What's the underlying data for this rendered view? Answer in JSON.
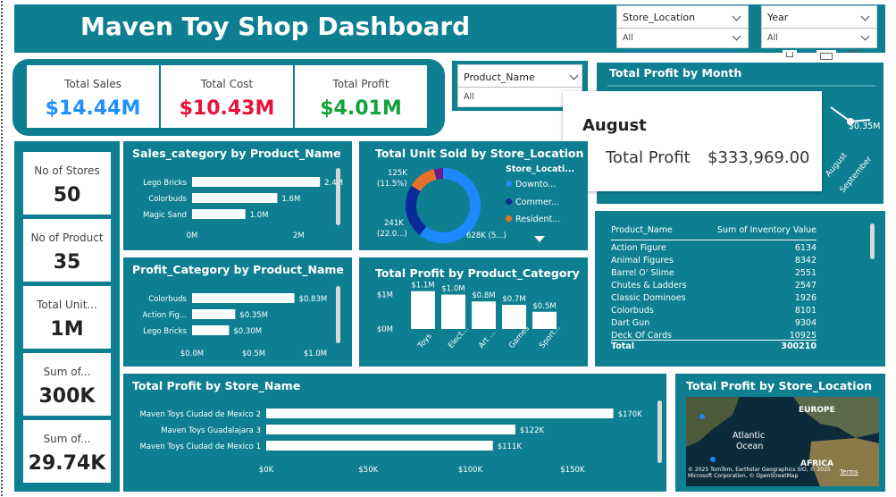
{
  "header": {
    "title": "Maven Toy Shop Dashboard"
  },
  "slicers": {
    "store_location": {
      "label": "Store_Location",
      "value": "All"
    },
    "year": {
      "label": "Year",
      "value": "All"
    },
    "product_name": {
      "label": "Product_Name",
      "value": "All"
    }
  },
  "kpis": [
    {
      "label": "Total Sales",
      "value": "$14.44M",
      "color": "#1e90ff"
    },
    {
      "label": "Total Cost",
      "value": "$10.43M",
      "color": "#e8123a"
    },
    {
      "label": "Total Profit",
      "value": "$4.01M",
      "color": "#14a33a"
    }
  ],
  "cards": [
    {
      "label": "No of Stores",
      "value": "50"
    },
    {
      "label": "No of Product",
      "value": "35"
    },
    {
      "label": "Total Unit...",
      "value": "1M"
    },
    {
      "label": "Sum of...",
      "value": "300K"
    },
    {
      "label": "Sum of...",
      "value": "29.74K"
    }
  ],
  "tooltip": {
    "title": "August",
    "label": "Total Profit",
    "value": "$333,969.00"
  },
  "monthly_chart": {
    "title": "Total Profit by Month",
    "value_label": "$0.35M",
    "tick_labels": [
      "August",
      "September"
    ]
  },
  "inventory_table": {
    "headers": [
      "Product_Name",
      "Sum of Inventory Value"
    ],
    "rows": [
      [
        "Action Figure",
        "6134"
      ],
      [
        "Animal Figures",
        "8342"
      ],
      [
        "Barrel O' Slime",
        "2551"
      ],
      [
        "Chutes & Ladders",
        "2547"
      ],
      [
        "Classic Dominoes",
        "1926"
      ],
      [
        "Colorbuds",
        "8101"
      ],
      [
        "Dart Gun",
        "9304"
      ],
      [
        "Deck Of Cards",
        "10925"
      ]
    ],
    "total": [
      "Total",
      "300210"
    ]
  },
  "map": {
    "title": "Total Profit by Store_Location",
    "labels": [
      "EUROPE",
      "Atlantic",
      "Ocean",
      "AFRICA"
    ],
    "attribution": "© 2025 TomTom, Earthstar Geographics SIO, © 2025 Microsoft Corporation, © OpenStreetMap",
    "terms": "Terms"
  },
  "chart_data": [
    {
      "type": "bar",
      "title": "Sales_category by Product_Name",
      "categories": [
        "Lego Bricks",
        "Colorbuds",
        "Magic Sand"
      ],
      "values": [
        2.4,
        1.6,
        1.0
      ],
      "value_labels": [
        "2.4M",
        "1.6M",
        "1.0M"
      ],
      "xlim": [
        0,
        2.8
      ],
      "ticks": [
        {
          "v": 0,
          "label": "0M"
        },
        {
          "v": 2,
          "label": "2M"
        }
      ]
    },
    {
      "type": "bar",
      "title": "Profit_Category by Product_Name",
      "categories": [
        "Colorbuds",
        "Action Fig...",
        "Lego Bricks"
      ],
      "values": [
        0.83,
        0.35,
        0.3
      ],
      "value_labels": [
        "$0.83M",
        "$0.35M",
        "$0.30M"
      ],
      "xlim": [
        0,
        1.0
      ],
      "ticks": [
        {
          "v": 0,
          "label": "$0.0M"
        },
        {
          "v": 0.5,
          "label": "$0.5M"
        },
        {
          "v": 1.0,
          "label": "$1.0M"
        }
      ]
    },
    {
      "type": "pie",
      "title": "Total Unit Sold by Store_Location",
      "legend_title": "Store_Locati...",
      "labels": [
        "Downto...",
        "Commer...",
        "Resident..."
      ],
      "colors": [
        "#1e88ff",
        "#0a2a9a",
        "#e8702a",
        "#6a1b8a"
      ],
      "values": [
        628,
        241,
        125,
        43
      ],
      "slice_labels": [
        "628K (5...)",
        "241K (22.0...)",
        "125K (11.5%)"
      ]
    },
    {
      "type": "bar",
      "title": "Total Profit by Product_Category",
      "categories": [
        "Toys",
        "Elect...",
        "Art ...",
        "Games",
        "Sport..."
      ],
      "values": [
        1.1,
        1.0,
        0.8,
        0.7,
        0.5
      ],
      "value_labels": [
        "$1.1M",
        "$1.0M",
        "$0.8M",
        "$0.7M",
        "$0.5M"
      ],
      "ylim": [
        0,
        1.3
      ],
      "ticks": [
        {
          "v": 0,
          "label": "$0M"
        },
        {
          "v": 1,
          "label": "$1M"
        }
      ]
    },
    {
      "type": "bar",
      "title": "Total Profit by Store_Name",
      "categories": [
        "Maven Toys Ciudad de Mexico 2",
        "Maven Toys Guadalajara 3",
        "Maven Toys Ciudad de Mexico 1"
      ],
      "values": [
        170,
        122,
        111
      ],
      "value_labels": [
        "$170K",
        "$122K",
        "$111K"
      ],
      "xlim": [
        0,
        175
      ],
      "ticks": [
        {
          "v": 0,
          "label": "$0K"
        },
        {
          "v": 50,
          "label": "$50K"
        },
        {
          "v": 100,
          "label": "$100K"
        },
        {
          "v": 150,
          "label": "$150K"
        }
      ]
    }
  ]
}
